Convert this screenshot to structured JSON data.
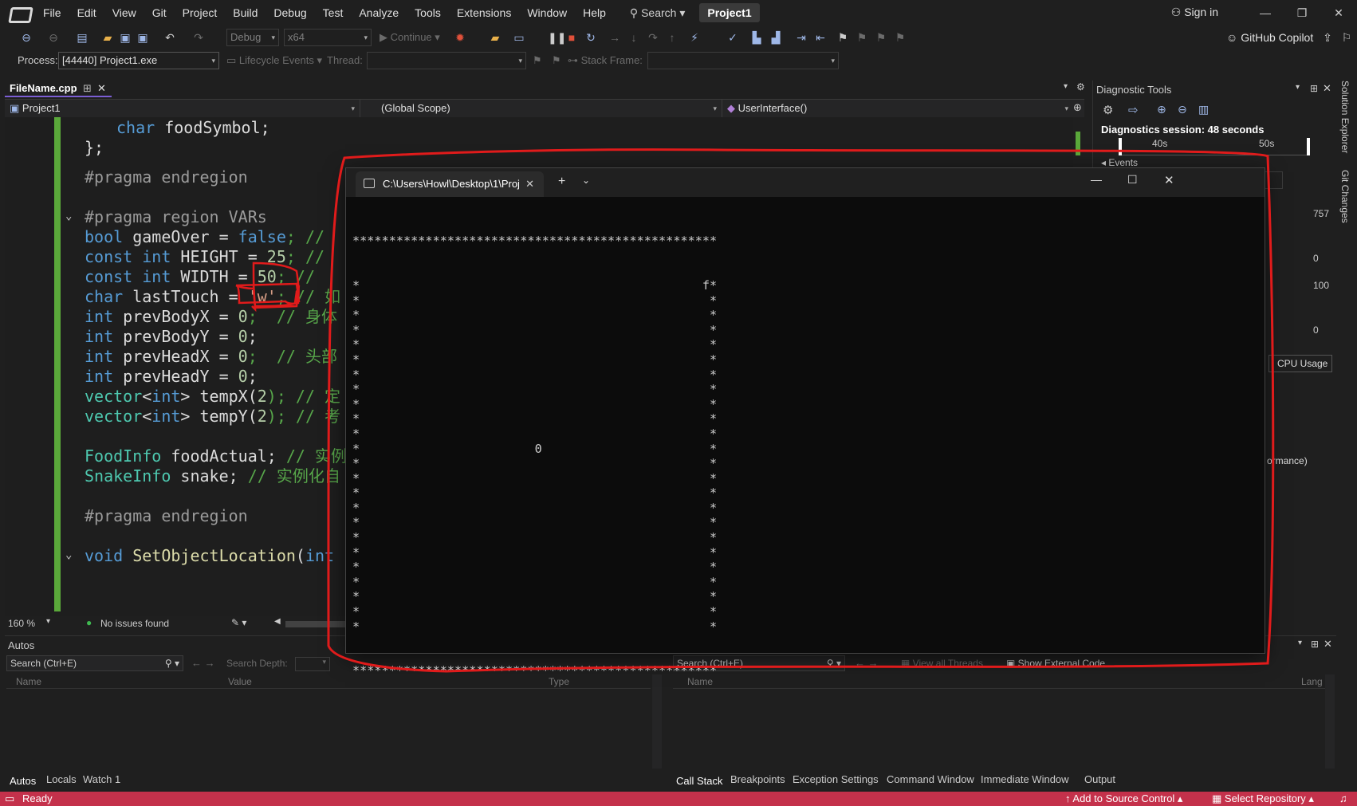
{
  "menu": {
    "items": [
      "File",
      "Edit",
      "View",
      "Git",
      "Project",
      "Build",
      "Debug",
      "Test",
      "Analyze",
      "Tools",
      "Extensions",
      "Window",
      "Help"
    ],
    "search_label": "Search",
    "project_name": "Project1",
    "sign_in": "Sign in",
    "copilot": "GitHub Copilot"
  },
  "toolbar": {
    "config": "Debug",
    "platform": "x64",
    "continue_label": "Continue"
  },
  "debug_bar": {
    "process_label": "Process:",
    "process_value": "[44440] Project1.exe",
    "lifecycle_label": "Lifecycle Events",
    "thread_label": "Thread:",
    "stackframe_label": "Stack Frame:"
  },
  "editor": {
    "tab_name": "FileName.cpp",
    "nav_project": "Project1",
    "nav_scope": "(Global Scope)",
    "nav_member": "UserInterface()",
    "zoom": "160 %",
    "issues": "No issues found"
  },
  "code": {
    "l1_kw": "char",
    "l1_rest": " foodSymbol;",
    "l2": "};",
    "l3": "#pragma endregion",
    "l4": "#pragma region VARs",
    "l5_kw": "bool",
    "l5_mid": " gameOver = ",
    "l5_val": "false",
    "l5_rest": "; // ",
    "l6_kw": "const int",
    "l6_mid": " HEIGHT = ",
    "l6_val": "25",
    "l6_rest": "; // ",
    "l7_kw": "const int",
    "l7_mid": " WIDTH = ",
    "l7_val": "50",
    "l7_rest": "; // ",
    "l8_kw": "char",
    "l8_mid": " lastTouch = ",
    "l8_val": "'w'",
    "l8_rest": "; // 如",
    "l9_kw": "int",
    "l9_mid": " prevBodyX = ",
    "l9_val": "0",
    "l9_rest": ";  // 身体",
    "l10_kw": "int",
    "l10_mid": " prevBodyY = ",
    "l10_val": "0",
    "l10_rest": ";",
    "l11_kw": "int",
    "l11_mid": " prevHeadX = ",
    "l11_val": "0",
    "l11_rest": ";  // 头部",
    "l12_kw": "int",
    "l12_mid": " prevHeadY = ",
    "l12_val": "0",
    "l12_rest": ";",
    "l13_ty": "vector",
    "l13_mid1": "<",
    "l13_kw": "int",
    "l13_mid2": "> tempX(",
    "l13_val": "2",
    "l13_rest": "); // 定",
    "l14_ty": "vector",
    "l14_mid1": "<",
    "l14_kw": "int",
    "l14_mid2": "> tempY(",
    "l14_val": "2",
    "l14_rest": "); // 考",
    "l15_ty": "FoodInfo",
    "l15_mid": " foodActual; ",
    "l15_cm": "// 实例",
    "l16_ty": "SnakeInfo",
    "l16_mid": " snake; ",
    "l16_cm": "// 实例化自",
    "l17": "#pragma endregion",
    "l18_kw": "void",
    "l18_fn": " SetObjectLocation",
    "l18_mid": "(",
    "l18_kw2": "int"
  },
  "diagnostics": {
    "title": "Diagnostic Tools",
    "session": "Diagnostics session: 48 seconds",
    "t40": "40s",
    "t50": "50s",
    "events": "Events",
    "v757": "757",
    "v0a": "0",
    "v100": "100",
    "v0b": "0",
    "cpu_tab": "CPU Usage",
    "perf": "ormance)"
  },
  "side_tabs": [
    "Solution Explorer",
    "Git Changes"
  ],
  "autos": {
    "title": "Autos",
    "search_placeholder": "Search (Ctrl+E)",
    "search_depth": "Search Depth:",
    "col_name": "Name",
    "col_value": "Value",
    "col_type": "Type",
    "tabs": [
      "Autos",
      "Locals",
      "Watch 1"
    ]
  },
  "callstack": {
    "search_placeholder": "Search (Ctrl+E)",
    "view_threads": "View all Threads",
    "show_external": "Show External Code",
    "col_name": "Name",
    "col_lang": "Lang",
    "tabs": [
      "Call Stack",
      "Breakpoints",
      "Exception Settings",
      "Command Window",
      "Immediate Window",
      "Output"
    ]
  },
  "status": {
    "ready": "Ready",
    "source_control": "Add to Source Control",
    "repository": "Select Repository"
  },
  "terminal": {
    "tab_title": "C:\\Users\\Howl\\Desktop\\1\\Proj",
    "border_row": "**************************************************",
    "food_char": "f",
    "snake_char": "0",
    "rows": 24,
    "width": 50,
    "food_col": 48,
    "food_row": 0,
    "snake_col": 25,
    "snake_row": 11
  },
  "colors": {
    "accent": "#7b5ed4",
    "status_bar": "#c4314b",
    "gutter": "#5aa83a",
    "annotation": "#e01b1b"
  }
}
